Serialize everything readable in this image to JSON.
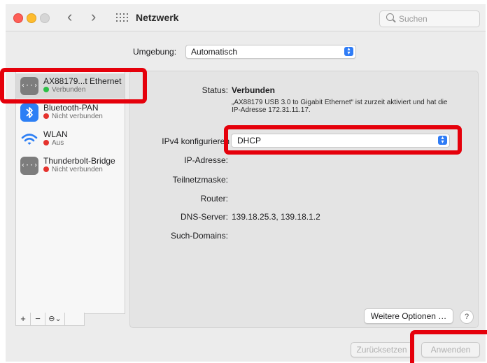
{
  "window": {
    "title": "Netzwerk",
    "search_placeholder": "Suchen",
    "back_glyph": "‹",
    "forward_glyph": "›"
  },
  "location": {
    "label": "Umgebung:",
    "value": "Automatisch"
  },
  "sidebar": {
    "items": [
      {
        "name": "AX88179...t Ethernet",
        "status": "Verbunden",
        "status_color": "#2dbf47",
        "icon": "ethernet-icon",
        "selected": true
      },
      {
        "name": "Bluetooth-PAN",
        "status": "Nicht verbunden",
        "status_color": "#e5322d",
        "icon": "bluetooth-icon"
      },
      {
        "name": "WLAN",
        "status": "Aus",
        "status_color": "#e5322d",
        "icon": "wifi-icon"
      },
      {
        "name": "Thunderbolt-Bridge",
        "status": "Nicht verbunden",
        "status_color": "#e5322d",
        "icon": "ethernet-icon"
      }
    ],
    "add_label": "+",
    "remove_label": "−",
    "action_label": "⊖⌄"
  },
  "details": {
    "status_label": "Status:",
    "status_value": "Verbunden",
    "status_description": "„AX88179 USB 3.0 to Gigabit Ethernet“ ist zurzeit aktiviert und hat die IP-Adresse 172.31.11.17.",
    "ipv4_label": "IPv4 konfigurieren",
    "ipv4_value": "DHCP",
    "ip_label": "IP-Adresse:",
    "subnet_label": "Teilnetzmaske:",
    "router_label": "Router:",
    "dns_label": "DNS-Server:",
    "dns_value": "139.18.25.3, 139.18.1.2",
    "search_domains_label": "Such-Domains:",
    "more_options_label": "Weitere Optionen …",
    "help_label": "?"
  },
  "footer": {
    "revert_label": "Zurücksetzen",
    "apply_label": "Anwenden"
  },
  "colors": {
    "accent": "#2f7cf6",
    "highlight": "#e5000b"
  }
}
